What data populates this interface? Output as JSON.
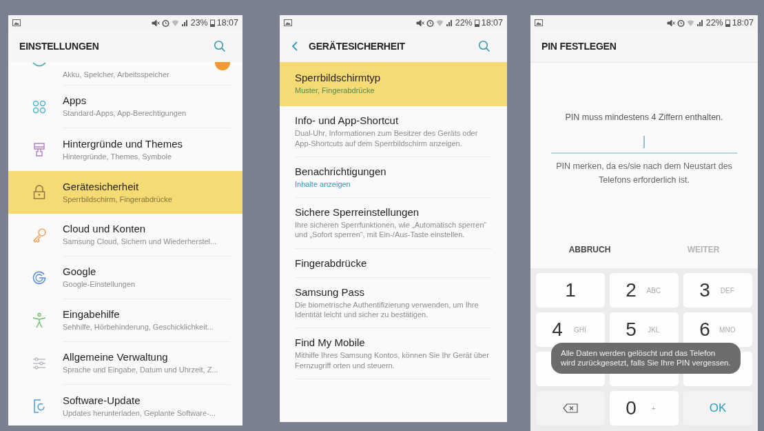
{
  "screens": [
    {
      "kind": "settings",
      "status": {
        "battery": "23%",
        "time": "18:07"
      },
      "title": "EINSTELLUNGEN",
      "back": false,
      "items": [
        {
          "subtitle": "Akku, Speicher, Arbeitsspeicher",
          "selected": false,
          "badge": true
        },
        {
          "title": "Apps",
          "subtitle": "Standard-Apps, App-Berechtigungen",
          "selected": false,
          "badge": false
        },
        {
          "title": "Hintergründe und Themes",
          "subtitle": "Hintergründe, Themes, Symbole",
          "selected": false,
          "badge": false
        },
        {
          "title": "Gerätesicherheit",
          "subtitle": "Sperrbildschirm, Fingerabdrücke",
          "selected": true,
          "badge": false
        },
        {
          "title": "Cloud und Konten",
          "subtitle": "Samsung Cloud, Sichern und Wiederherstel...",
          "selected": false,
          "badge": false
        },
        {
          "title": "Google",
          "subtitle": "Google-Einstellungen",
          "selected": false,
          "badge": false
        },
        {
          "title": "Eingabehilfe",
          "subtitle": "Sehhilfe, Hörbehinderung, Geschicklichkeit...",
          "selected": false,
          "badge": false
        },
        {
          "title": "Allgemeine Verwaltung",
          "subtitle": "Sprache und Eingabe, Datum und Uhrzeit, Z...",
          "selected": false,
          "badge": false
        },
        {
          "title": "Software-Update",
          "subtitle": "Updates herunterladen, Geplante Software-...",
          "selected": false,
          "badge": false
        }
      ]
    },
    {
      "kind": "security",
      "status": {
        "battery": "22%",
        "time": "18:07"
      },
      "title": "GERÄTESICHERHEIT",
      "back": true,
      "items": [
        {
          "title": "Sperrbildschirmtyp",
          "subtitle": "Muster, Fingerabdrücke",
          "accent": true,
          "selected": true
        },
        {
          "title": "Info- und App-Shortcut",
          "subtitle": "Dual-Uhr, Informationen zum Besitzer des Geräts oder App-Shortcuts auf dem Sperrbildschirm anzeigen.",
          "accent": false,
          "selected": false
        },
        {
          "title": "Benachrichtigungen",
          "subtitle": "Inhalte anzeigen",
          "accent": true,
          "selected": false
        },
        {
          "title": "Sichere Sperreinstellungen",
          "subtitle": "Ihre sicheren Sperrfunktionen, wie „Automatisch sperren“ und „Sofort sperren“, mit Ein-/Aus-Taste einstellen.",
          "accent": false,
          "selected": false
        },
        {
          "title": "Fingerabdrücke",
          "selected": false
        },
        {
          "title": "Samsung Pass",
          "subtitle": "Die biometrische Authentifizierung verwenden, um Ihre Identität leicht und sicher zu bestätigen.",
          "accent": false,
          "selected": false
        },
        {
          "title": "Find My Mobile",
          "subtitle": "Mithilfe Ihres Samsung Kontos, können Sie Ihr Gerät über Fernzugriff orten und steuern.",
          "accent": false,
          "selected": false
        }
      ]
    },
    {
      "kind": "pin",
      "status": {
        "battery": "22%",
        "time": "18:07"
      },
      "title": "PIN FESTLEGEN",
      "back": false,
      "message": "PIN muss mindestens 4 Ziffern enthalten.",
      "hint": "PIN merken, da es/sie nach dem Neustart des Telefons erforderlich ist.",
      "buttons": [
        {
          "label": "ABBRUCH",
          "disabled": false
        },
        {
          "label": "WEITER",
          "disabled": true
        }
      ],
      "keys": [
        {
          "kind": "digit",
          "digit": "1"
        },
        {
          "kind": "digit",
          "digit": "2",
          "letters": "ABC"
        },
        {
          "kind": "digit",
          "digit": "3",
          "letters": "DEF"
        },
        {
          "kind": "digit",
          "digit": "4",
          "letters": "GHI"
        },
        {
          "kind": "digit",
          "digit": "5",
          "letters": "JKL"
        },
        {
          "kind": "digit",
          "digit": "6",
          "letters": "MNO"
        },
        {
          "kind": "blank"
        },
        {
          "kind": "blank"
        },
        {
          "kind": "blank"
        },
        {
          "kind": "backspace"
        },
        {
          "kind": "digit",
          "digit": "0",
          "letters": "+"
        },
        {
          "kind": "ok",
          "label": "OK"
        }
      ],
      "toast": "Alle Daten werden gelöscht und das Telefon wird zurückgesetzt, falls Sie Ihre PIN vergessen."
    }
  ]
}
